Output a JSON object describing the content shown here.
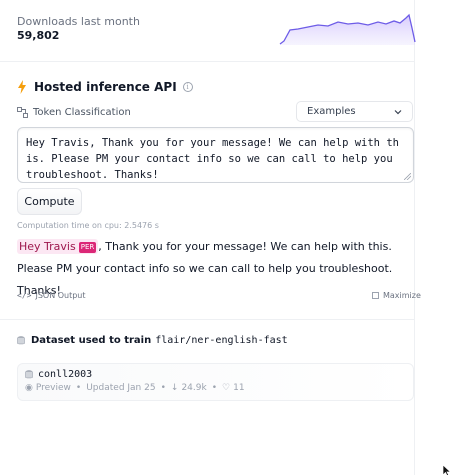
{
  "downloads": {
    "label": "Downloads last month",
    "value": "59,802",
    "sparkline_color": "#7c6ef0"
  },
  "inference": {
    "title": "Hosted inference API",
    "info_icon": "info-icon",
    "task_icon": "token-classification-icon",
    "task_label": "Token Classification",
    "examples_label": "Examples",
    "input_text": "Hey Travis, Thank you for your message! We can help with this. Please PM your contact info so we can call to help you troubleshoot. Thanks!",
    "compute_label": "Compute",
    "compute_time": "Computation time on cpu: 2.5476 s",
    "output": {
      "entity_text": "Hey Travis",
      "entity_tag": "PER",
      "rest_text": ", Thank you for your message! We can help with this. Please PM your contact info so we can call to help you troubleshoot. Thanks!",
      "entity_bg": "#fce7f3",
      "tag_color": "#db2777"
    },
    "json_output_label": "JSON Output",
    "maximize_label": "Maximize"
  },
  "dataset": {
    "label": "Dataset used to train",
    "model": "flair/ner-english-fast",
    "card": {
      "name": "conll2003",
      "preview": "Preview",
      "updated": "Updated Jan 25",
      "downloads": "24.9k",
      "likes": "11"
    }
  }
}
